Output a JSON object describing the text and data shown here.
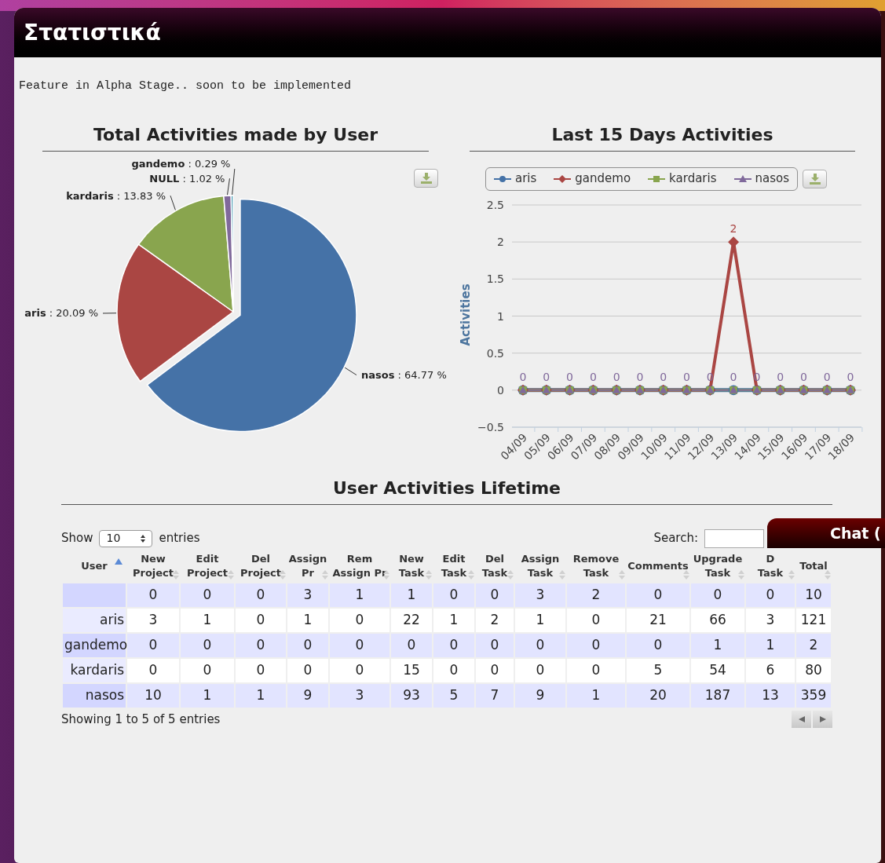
{
  "page_title": "Στατιστικά",
  "notice": "Feature in Alpha Stage.. soon to be implemented",
  "pie_panel": {
    "title": "Total Activities made by User",
    "chart_data": {
      "type": "pie",
      "categories": [
        "nasos",
        "aris",
        "kardaris",
        "NULL",
        "gandemo"
      ],
      "values": [
        64.77,
        20.09,
        13.83,
        1.02,
        0.29
      ],
      "value_labels": [
        ": 64.77 %",
        ": 20.09 %",
        ": 13.83 %",
        ": 1.02 %",
        ": 0.29 %"
      ]
    }
  },
  "line_panel": {
    "title": "Last 15 Days Activities",
    "chart_data": {
      "type": "line",
      "ylabel": "Activities",
      "categories": [
        "04/09",
        "05/09",
        "06/09",
        "07/09",
        "08/09",
        "09/09",
        "10/09",
        "11/09",
        "12/09",
        "13/09",
        "14/09",
        "15/09",
        "16/09",
        "17/09",
        "18/09"
      ],
      "ylim": [
        -0.5,
        2.5
      ],
      "yticks": [
        -0.5,
        0,
        0.5,
        1,
        1.5,
        2,
        2.5
      ],
      "grid": true,
      "legend": "top",
      "series": [
        {
          "name": "aris",
          "color": "#4572a7",
          "marker": "circle",
          "values": [
            0,
            0,
            0,
            0,
            0,
            0,
            0,
            0,
            0,
            0,
            0,
            0,
            0,
            0,
            0
          ],
          "value_labels": [
            null,
            null,
            null,
            null,
            null,
            null,
            null,
            null,
            null,
            null,
            null,
            null,
            null,
            null,
            null
          ]
        },
        {
          "name": "gandemo",
          "color": "#aa4643",
          "marker": "diamond",
          "values": [
            0,
            0,
            0,
            0,
            0,
            0,
            0,
            0,
            0,
            2,
            0,
            0,
            0,
            0,
            0
          ],
          "value_labels": [
            null,
            null,
            null,
            null,
            null,
            null,
            null,
            null,
            null,
            "2",
            null,
            null,
            null,
            null,
            null
          ]
        },
        {
          "name": "kardaris",
          "color": "#89a54e",
          "marker": "square",
          "values": [
            0,
            0,
            0,
            0,
            0,
            0,
            0,
            0,
            0,
            0,
            0,
            0,
            0,
            0,
            0
          ],
          "value_labels": [
            null,
            null,
            null,
            null,
            null,
            null,
            null,
            null,
            null,
            null,
            null,
            null,
            null,
            null,
            null
          ]
        },
        {
          "name": "nasos",
          "color": "#80699b",
          "marker": "triangle",
          "values": [
            0,
            0,
            0,
            0,
            0,
            0,
            0,
            0,
            0,
            0,
            0,
            0,
            0,
            0,
            0
          ],
          "value_labels": [
            "0",
            "0",
            "0",
            "0",
            "0",
            "0",
            "0",
            "0",
            "0",
            "0",
            "0",
            "0",
            "0",
            "0",
            "0"
          ]
        }
      ]
    }
  },
  "table_panel": {
    "title": "User Activities Lifetime",
    "show_label": "Show",
    "length_value": "10",
    "entries_label": "entries",
    "search_label": "Search:",
    "columns": [
      {
        "lines": [
          "User"
        ],
        "sorted": true
      },
      {
        "lines": [
          "New",
          "Project"
        ],
        "sorted": false
      },
      {
        "lines": [
          "Edit",
          "Project"
        ],
        "sorted": false
      },
      {
        "lines": [
          "Del",
          "Project"
        ],
        "sorted": false
      },
      {
        "lines": [
          "Assign",
          "Pr"
        ],
        "sorted": false
      },
      {
        "lines": [
          "Rem",
          "Assign Pr"
        ],
        "sorted": false
      },
      {
        "lines": [
          "New",
          "Task"
        ],
        "sorted": false
      },
      {
        "lines": [
          "Edit",
          "Task"
        ],
        "sorted": false
      },
      {
        "lines": [
          "Del",
          "Task"
        ],
        "sorted": false
      },
      {
        "lines": [
          "Assign",
          "Task"
        ],
        "sorted": false
      },
      {
        "lines": [
          "Remove",
          "Task"
        ],
        "sorted": false
      },
      {
        "lines": [
          "Comments"
        ],
        "sorted": false
      },
      {
        "lines": [
          "Upgrade",
          "Task"
        ],
        "sorted": false
      },
      {
        "lines": [
          "D",
          "Task"
        ],
        "sorted": false
      },
      {
        "lines": [
          "Total"
        ],
        "sorted": false
      }
    ],
    "rows": [
      {
        "values": [
          "0",
          "0",
          "0",
          "3",
          "1",
          "1",
          "0",
          "0",
          "3",
          "2",
          "0",
          "0",
          "0",
          "10"
        ]
      },
      {
        "user": "aris",
        "values": [
          "3",
          "1",
          "0",
          "1",
          "0",
          "22",
          "1",
          "2",
          "1",
          "0",
          "21",
          "66",
          "3",
          "121"
        ]
      },
      {
        "user": "gandemo",
        "values": [
          "0",
          "0",
          "0",
          "0",
          "0",
          "0",
          "0",
          "0",
          "0",
          "0",
          "0",
          "1",
          "1",
          "2"
        ]
      },
      {
        "user": "kardaris",
        "values": [
          "0",
          "0",
          "0",
          "0",
          "0",
          "15",
          "0",
          "0",
          "0",
          "0",
          "5",
          "54",
          "6",
          "80"
        ]
      },
      {
        "user": "nasos",
        "values": [
          "10",
          "1",
          "1",
          "9",
          "3",
          "93",
          "5",
          "7",
          "9",
          "1",
          "20",
          "187",
          "13",
          "359"
        ]
      }
    ],
    "info": "Showing 1 to 5 of 5 entries"
  },
  "chat": {
    "label": "Chat ("
  }
}
